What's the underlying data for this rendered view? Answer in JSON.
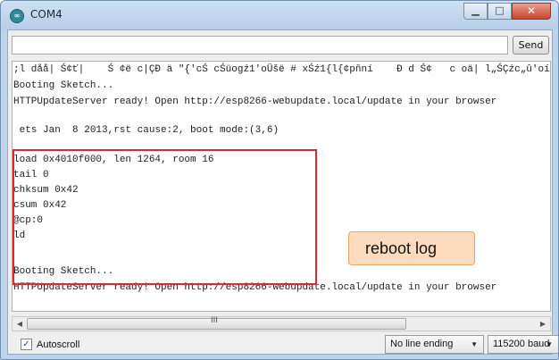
{
  "window": {
    "title": "COM4"
  },
  "toolbar": {
    "send_label": "Send",
    "input_value": ""
  },
  "console": {
    "lines": [
      ";l dåå| Ś¢ť|    Ś ¢ë c|ÇÐ ä \"{'cŚ cŚüogź1'oÜšë # xŚź1{l{¢pňní    Ð d Ś¢   c oä| l„ŚÇźc„û'oí",
      "Booting Sketch...",
      "HTTPUpdateServer ready! Open http://esp8266-webupdate.local/update in your browser",
      "",
      " ets Jan  8 2013,rst cause:2, boot mode:(3,6)",
      "",
      "load 0x4010f000, len 1264, room 16",
      "tail 0",
      "chksum 0x42",
      "csum 0x42",
      "@cp:0",
      "ld",
      "",
      "Booting Sketch...",
      "HTTPUpdateServer ready! Open http://esp8266-webupdate.local/update in your browser"
    ]
  },
  "annotation": {
    "callout_text": "reboot log",
    "box_color": "#e3262f",
    "callout_fill": "#fcdcbc"
  },
  "scrollbar": {
    "grip": "III"
  },
  "footer": {
    "autoscroll_label": "Autoscroll",
    "autoscroll_checked": true,
    "line_ending": "No line ending",
    "baud": "115200 baud"
  },
  "icons": {
    "app": "arduino-icon",
    "minimize": "minimize-icon",
    "maximize": "maximize-icon",
    "close": "close-icon"
  }
}
